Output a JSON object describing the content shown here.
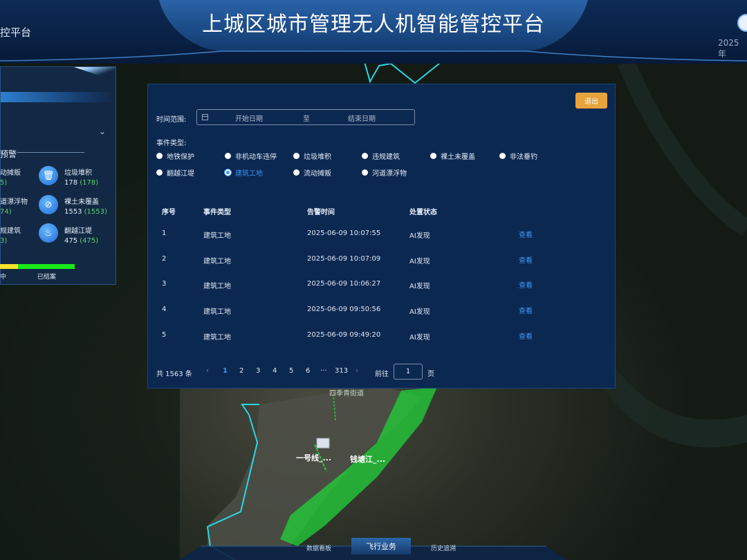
{
  "header": {
    "title": "上城区城市管理无人机智能管控平台",
    "left_title": "控平台",
    "right_date": "2025年"
  },
  "left_panel": {
    "section_title": "预警",
    "stats": [
      {
        "label": "动摊贩",
        "value": "5"
      },
      {
        "label": "道漂浮物",
        "value": "74"
      },
      {
        "label": "规建筑",
        "value": "3"
      }
    ],
    "icon_stats": [
      {
        "label": "垃圾堆积",
        "count": "178",
        "sub": "(178)",
        "icon": "trash-icon"
      },
      {
        "label": "裸土未覆盖",
        "count": "1553",
        "sub": "(1553)",
        "icon": "no-dust-icon"
      },
      {
        "label": "翻越江堤",
        "count": "475",
        "sub": "(475)",
        "icon": "flame-icon"
      }
    ],
    "progress": {
      "in_progress_label": "中",
      "closed_label": "已结案",
      "in_progress_fraction": 0.24,
      "closed_fraction": 0.76
    },
    "colors": {
      "in_progress": "#f7e52b",
      "closed": "#18ea18"
    }
  },
  "modal": {
    "exit_label": "退出",
    "time_range_label": "时间范围:",
    "start_placeholder": "开始日期",
    "range_sep": "至",
    "end_placeholder": "结束日期",
    "event_type_label": "事件类型:",
    "event_types": [
      "地铁保护",
      "非机动车违停",
      "垃圾堆积",
      "违规建筑",
      "裸土未覆盖",
      "非法垂钓",
      "翻越江堤",
      "建筑工地",
      "流动摊贩",
      "河道漂浮物"
    ],
    "selected_event_type": "建筑工地",
    "table": {
      "headers": [
        "序号",
        "事件类型",
        "告警时间",
        "处置状态"
      ],
      "rows": [
        {
          "no": "1",
          "type": "建筑工地",
          "time": "2025-06-09 10:07:55",
          "status": "AI发现",
          "action": "查看"
        },
        {
          "no": "2",
          "type": "建筑工地",
          "time": "2025-06-09 10:07:09",
          "status": "AI发现",
          "action": "查看"
        },
        {
          "no": "3",
          "type": "建筑工地",
          "time": "2025-06-09 10:06:27",
          "status": "AI发现",
          "action": "查看"
        },
        {
          "no": "4",
          "type": "建筑工地",
          "time": "2025-06-09 09:50:56",
          "status": "AI发现",
          "action": "查看"
        },
        {
          "no": "5",
          "type": "建筑工地",
          "time": "2025-06-09 09:49:20",
          "status": "AI发现",
          "action": "查看"
        }
      ]
    },
    "pagination": {
      "total": "共 1563 条",
      "prev": "‹",
      "pages": [
        "1",
        "2",
        "3",
        "4",
        "5",
        "6"
      ],
      "ellipsis": "···",
      "last": "313",
      "next": "›",
      "goto_label": "前往",
      "goto_value": "1",
      "page_unit": "页",
      "current": "1"
    }
  },
  "map": {
    "labels": [
      {
        "text": "一号线_..."
      },
      {
        "text": "钱塘江_..."
      }
    ],
    "road_label": "四季青街道",
    "colors": {
      "boundary": "#28d7ea",
      "river_zone": "#22d13a"
    }
  },
  "bottom_nav": {
    "tabs": [
      {
        "label": "数据看板",
        "active": false
      },
      {
        "label": "飞行业务",
        "active": true
      },
      {
        "label": "历史追溯",
        "active": false
      }
    ]
  }
}
